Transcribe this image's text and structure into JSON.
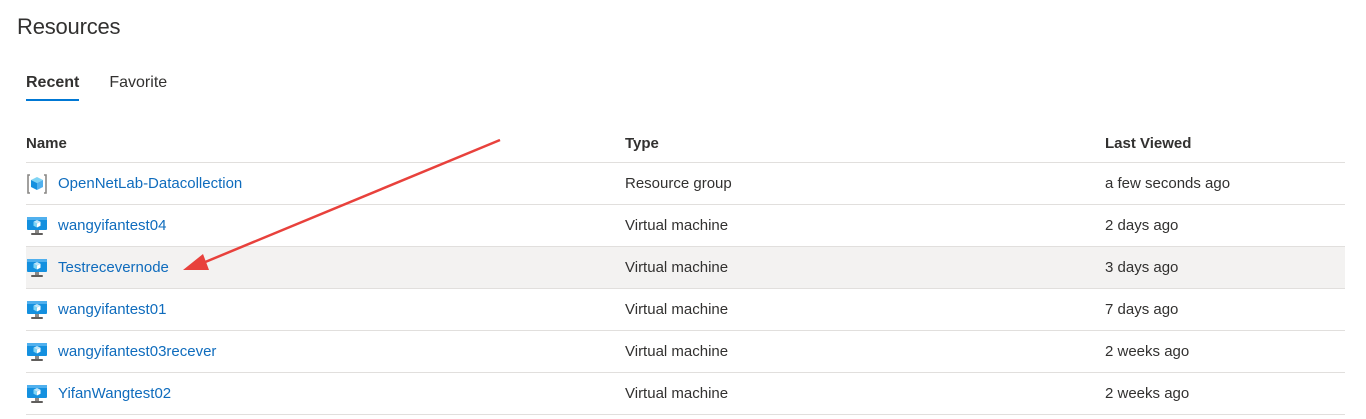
{
  "title": "Resources",
  "tabs": [
    {
      "label": "Recent",
      "active": true
    },
    {
      "label": "Favorite",
      "active": false
    }
  ],
  "columns": {
    "name": "Name",
    "type": "Type",
    "last_viewed": "Last Viewed"
  },
  "rows": [
    {
      "name": "OpenNetLab-Datacollection",
      "type": "Resource group",
      "last_viewed": "a few seconds ago",
      "icon": "resource-group-icon"
    },
    {
      "name": "wangyifantest04",
      "type": "Virtual machine",
      "last_viewed": "2 days ago",
      "icon": "virtual-machine-icon"
    },
    {
      "name": "Testrecevernode",
      "type": "Virtual machine",
      "last_viewed": "3 days ago",
      "icon": "virtual-machine-icon"
    },
    {
      "name": "wangyifantest01",
      "type": "Virtual machine",
      "last_viewed": "7 days ago",
      "icon": "virtual-machine-icon"
    },
    {
      "name": "wangyifantest03recever",
      "type": "Virtual machine",
      "last_viewed": "2 weeks ago",
      "icon": "virtual-machine-icon"
    },
    {
      "name": "YifanWangtest02",
      "type": "Virtual machine",
      "last_viewed": "2 weeks ago",
      "icon": "virtual-machine-icon"
    }
  ],
  "colors": {
    "link": "#0f6cbd",
    "accent": "#0078d4",
    "annotation_arrow": "#e8413c",
    "row_highlight": "#f3f2f1"
  }
}
